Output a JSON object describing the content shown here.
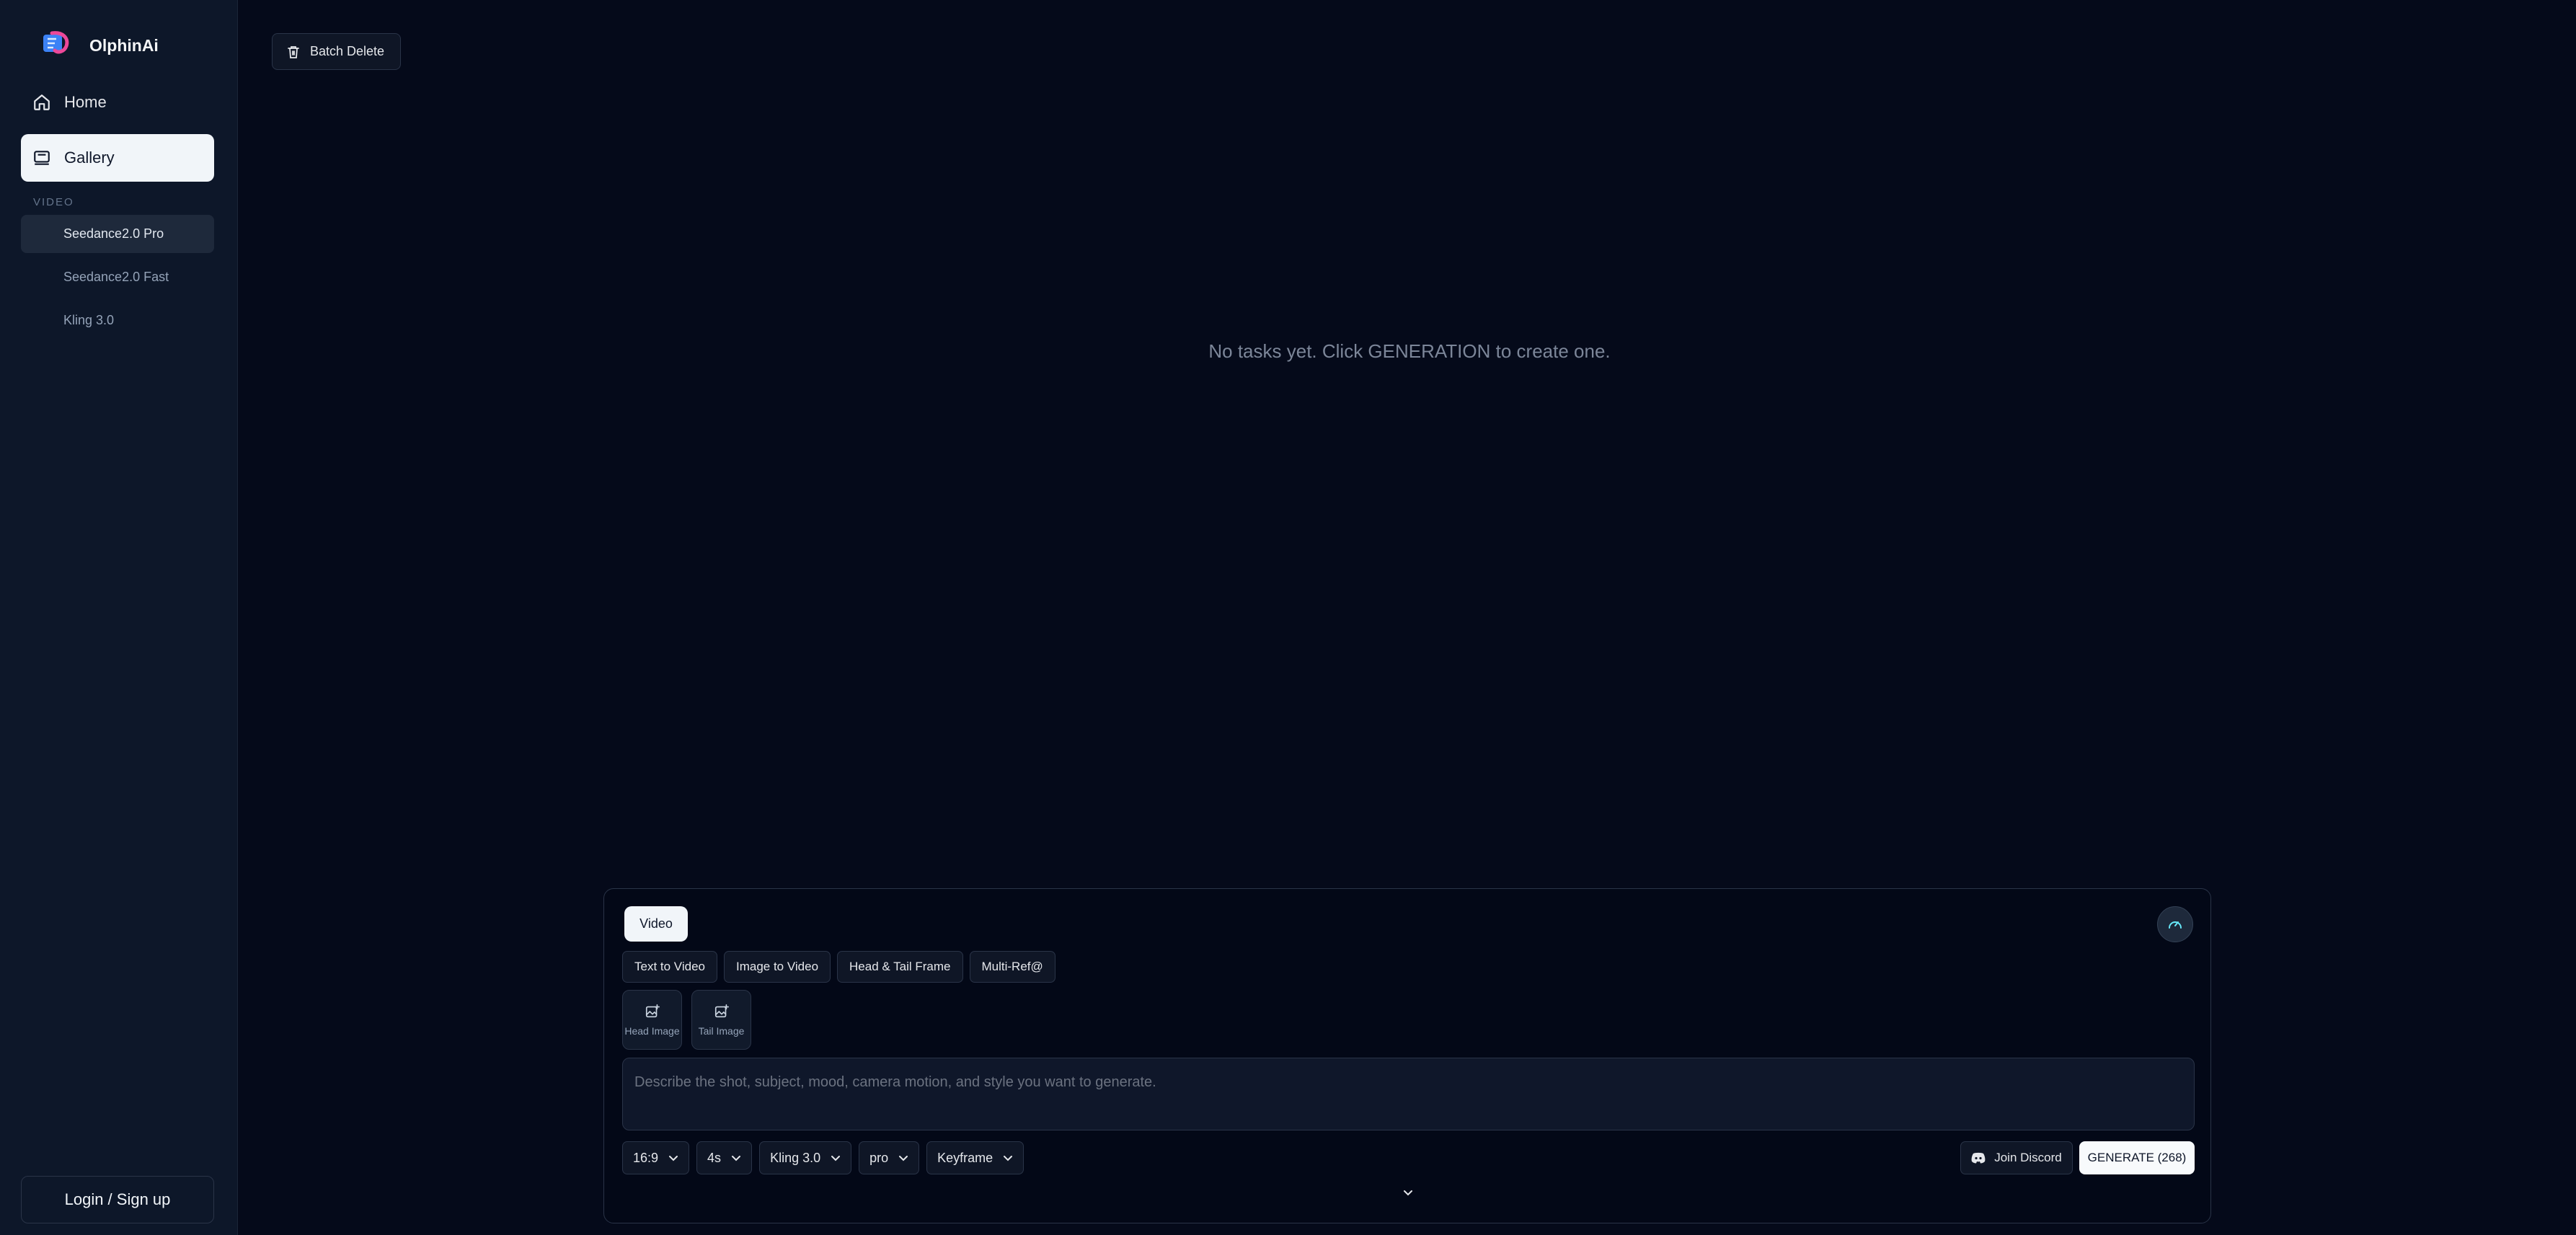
{
  "brand": {
    "name": "OlphinAi"
  },
  "sidebar": {
    "nav": [
      {
        "label": "Home",
        "icon": "home-icon"
      },
      {
        "label": "Gallery",
        "icon": "gallery-icon",
        "active": true
      }
    ],
    "section_label": "VIDEO",
    "models": [
      {
        "label": "Seedance2.0 Pro",
        "active": true
      },
      {
        "label": "Seedance2.0 Fast"
      },
      {
        "label": "Kling 3.0"
      }
    ],
    "login_label": "Login / Sign up"
  },
  "main": {
    "batch_delete_label": "Batch Delete",
    "empty_message": "No tasks yet. Click GENERATION to create one."
  },
  "composer": {
    "mode_tab": "Video",
    "types": [
      "Text to Video",
      "Image to Video",
      "Head & Tail Frame",
      "Multi-Ref@"
    ],
    "uploads": [
      "Head Image",
      "Tail Image"
    ],
    "prompt_placeholder": "Describe the shot, subject, mood, camera motion, and style you want to generate.",
    "options": {
      "aspect": "16:9",
      "duration": "4s",
      "model": "Kling 3.0",
      "quality": "pro",
      "mode": "Keyframe"
    },
    "discord_label": "Join Discord",
    "generate_label": "GENERATE (268)"
  },
  "colors": {
    "background": "#050a1a",
    "sidebar": "#0d1729",
    "accent_logo_blue": "#3b82f6",
    "accent_logo_pink": "#ec4899"
  }
}
